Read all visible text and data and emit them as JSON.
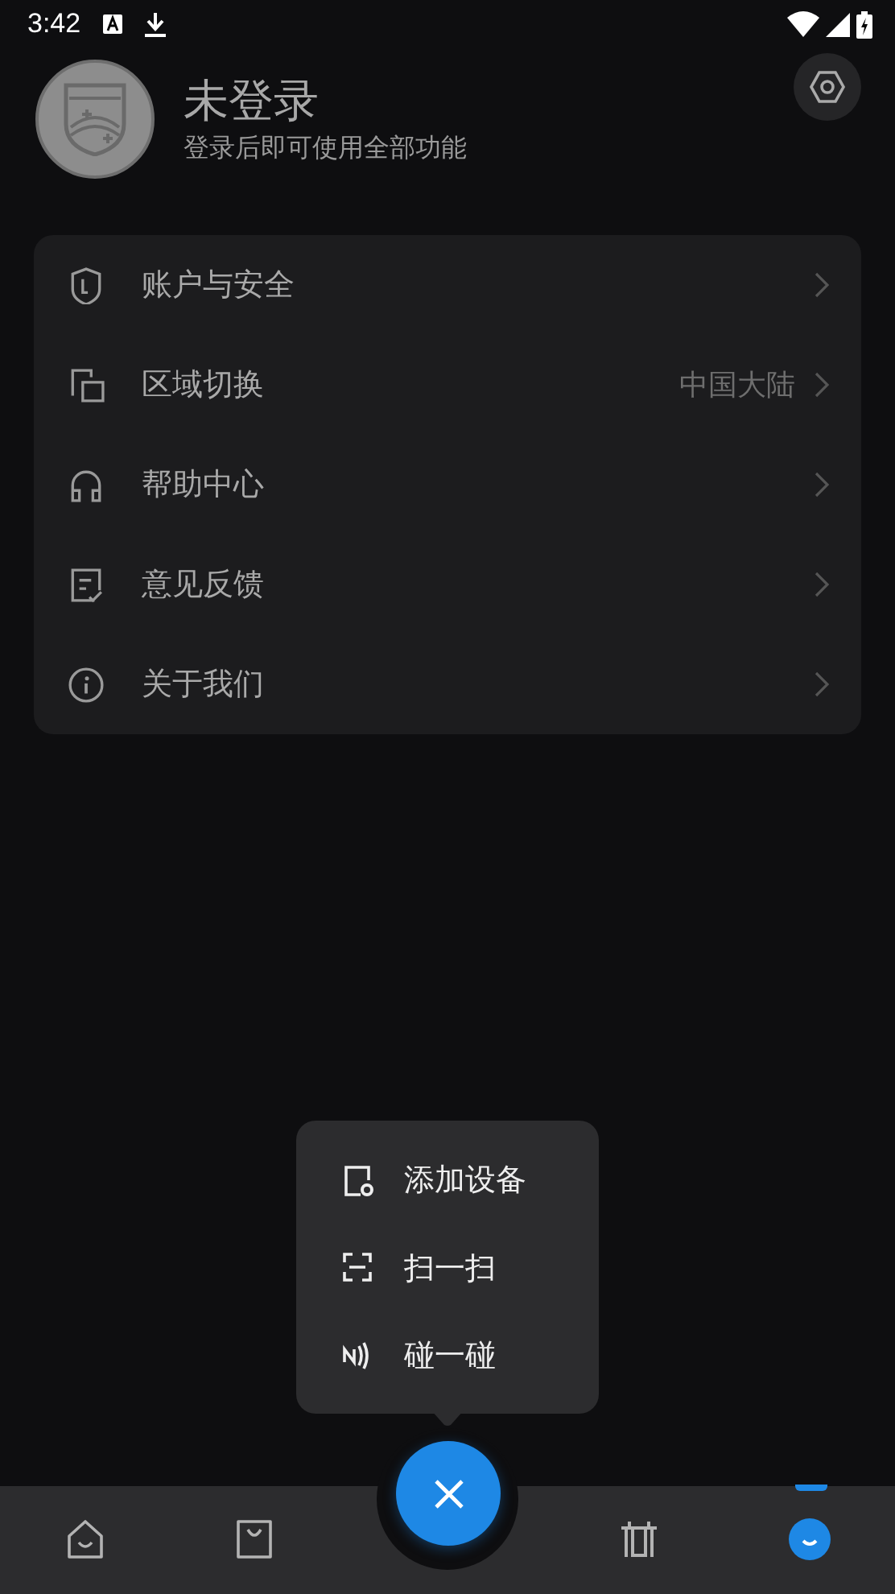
{
  "status_bar": {
    "time": "3:42"
  },
  "profile": {
    "title": "未登录",
    "subtitle": "登录后即可使用全部功能"
  },
  "menu": [
    {
      "kind": "shield",
      "label": "账户与安全"
    },
    {
      "kind": "region",
      "label": "区域切换",
      "value": "中国大陆"
    },
    {
      "kind": "headset",
      "label": "帮助中心"
    },
    {
      "kind": "feedback",
      "label": "意见反馈"
    },
    {
      "kind": "info",
      "label": "关于我们"
    }
  ],
  "popup": [
    {
      "kind": "add",
      "label": "添加设备"
    },
    {
      "kind": "scan",
      "label": "扫一扫"
    },
    {
      "kind": "nfc",
      "label": "碰一碰"
    }
  ],
  "nav": [
    {
      "kind": "home",
      "selected": false
    },
    {
      "kind": "bag",
      "selected": false
    },
    {
      "kind": "device",
      "selected": false
    },
    {
      "kind": "me",
      "selected": true
    }
  ]
}
